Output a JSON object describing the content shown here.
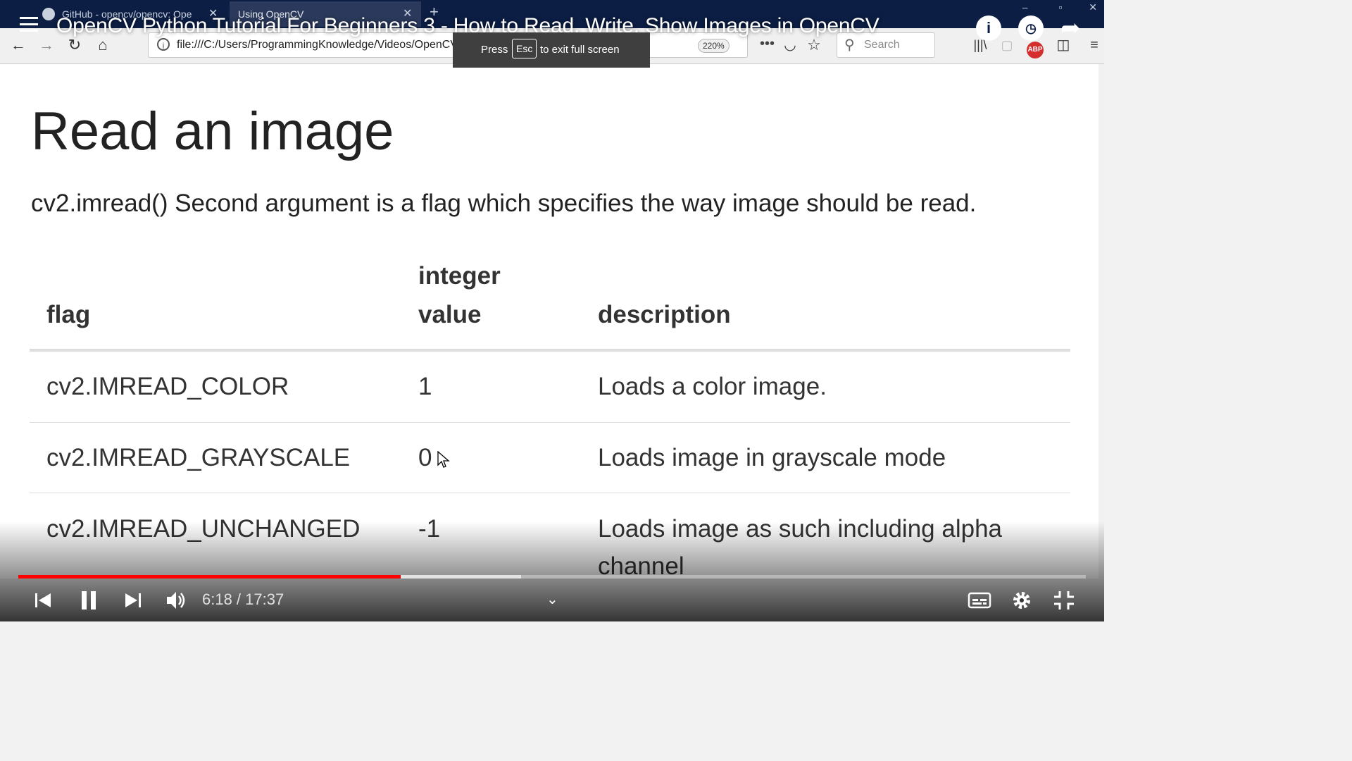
{
  "browser": {
    "tabs": [
      {
        "label": "GitHub - opencv/opencv: Ope",
        "active": false
      },
      {
        "label": "Using OpenCV",
        "active": true
      }
    ],
    "url": "file:///C:/Users/ProgrammingKnowledge/Videos/OpenCV/Tutorial/Using OpenCV",
    "zoom": "220%",
    "search_placeholder": "Search",
    "abp_badge": "ABP"
  },
  "video": {
    "title": "OpenCV Python Tutorial For Beginners 3 - How to Read, Write, Show Images in OpenCV",
    "time": "6:18 / 17:37",
    "progress_fraction": 0.358,
    "buffer_fraction": 0.471,
    "fullscreen_toast": {
      "press": "Press",
      "key": "Esc",
      "rest": "to exit full screen"
    }
  },
  "page": {
    "heading": "Read an image",
    "lead": "cv2.imread() Second argument is a flag which specifies the way image should be read.",
    "table": {
      "headers": [
        "flag",
        "integer",
        "value",
        "description"
      ],
      "rows": [
        {
          "flag": "cv2.IMREAD_COLOR",
          "value": "1",
          "description": "Loads a color image.",
          "description2": ""
        },
        {
          "flag": "cv2.IMREAD_GRAYSCALE",
          "value": "0",
          "description": "Loads image in grayscale mode",
          "description2": ""
        },
        {
          "flag": "cv2.IMREAD_UNCHANGED",
          "value": "-1",
          "description": "Loads image as such including alpha",
          "description2": "channel"
        }
      ]
    }
  },
  "colors": {
    "progress_played": "#ff0000",
    "tabbar_bg": "#0c1e44",
    "abp_red": "#d32f2f"
  }
}
